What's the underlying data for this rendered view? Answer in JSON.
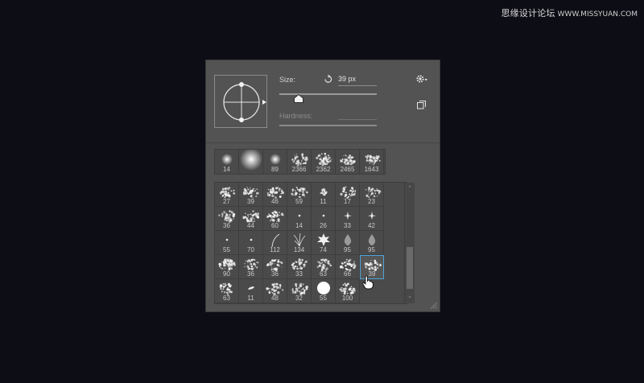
{
  "watermark": {
    "cn": "思缘设计论坛",
    "url": "WWW.MISSYUAN.COM"
  },
  "panel": {
    "size_label": "Size:",
    "size_value": "39 px",
    "hardness_label": "Hardness:",
    "size_slider_level": 0.2
  },
  "icons": {
    "reset": "reset-icon",
    "gear": "gear-icon",
    "new_preset": "new-preset-icon",
    "scroll_up": "chevron-up-icon",
    "scroll_down": "chevron-down-icon"
  },
  "recent_presets": [
    "14",
    "",
    "89",
    "2366",
    "2362",
    "2465",
    "1643"
  ],
  "brush_grid": [
    [
      "27",
      "39",
      "46",
      "59",
      "11",
      "17",
      "23"
    ],
    [
      "36",
      "44",
      "60",
      "14",
      "26",
      "33",
      "42"
    ],
    [
      "55",
      "70",
      "112",
      "134",
      "74",
      "95",
      "95"
    ],
    [
      "90",
      "36",
      "36",
      "33",
      "63",
      "66",
      "39"
    ],
    [
      "63",
      "11",
      "48",
      "32",
      "55",
      "100"
    ]
  ],
  "selected_brush": "39",
  "colors": {
    "selection": "#4fa3d8",
    "panel_bg": "#535353"
  }
}
